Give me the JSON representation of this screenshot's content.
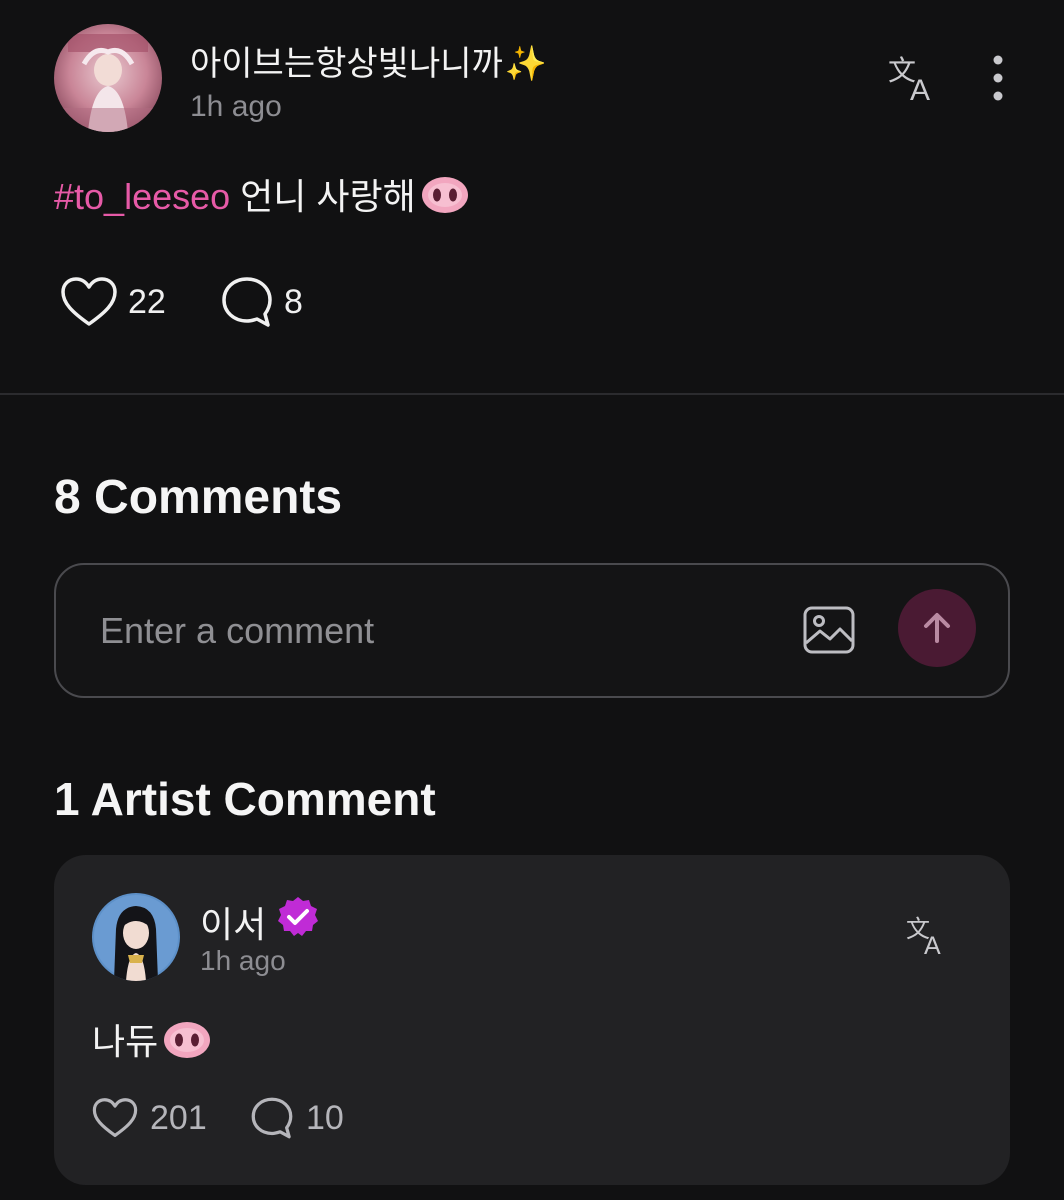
{
  "post": {
    "username": "아이브는항상빛나니까",
    "username_emoji": "✨",
    "timestamp": "1h ago",
    "hashtag": "#to_leeseo",
    "body_text": "언니 사랑해",
    "body_emoji": "pig-nose",
    "likes": "22",
    "comments": "8",
    "icons": {
      "translate": "translate-icon",
      "more": "more-vertical-icon",
      "like": "heart-icon",
      "comment": "speech-bubble-icon"
    }
  },
  "comments_section": {
    "title": "8 Comments",
    "input_placeholder": "Enter a comment",
    "icons": {
      "image": "image-icon",
      "send": "arrow-up-icon"
    }
  },
  "artist_section": {
    "title": "1 Artist Comment",
    "comment": {
      "name": "이서",
      "verified": true,
      "timestamp": "1h ago",
      "text": "나듀",
      "text_emoji": "pig-nose",
      "likes": "201",
      "replies": "10"
    }
  },
  "colors": {
    "background": "#111112",
    "hashtag": "#e65aa7",
    "send_button": "#4a1a33",
    "card": "#222224",
    "verified_badge": "#c02bd6"
  }
}
